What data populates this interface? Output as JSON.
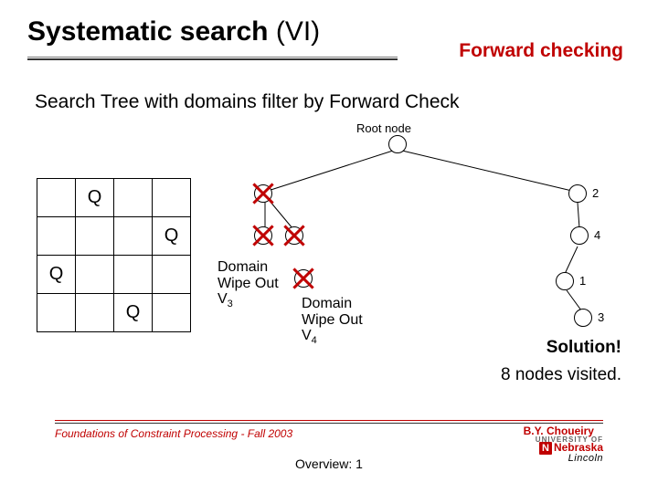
{
  "title": {
    "main": "Systematic search",
    "paren": " (VI)",
    "right": "Forward checking"
  },
  "subtitle": "Search Tree with domains filter by Forward Check",
  "root_label": "Root node",
  "wipe1": {
    "l1": "Domain",
    "l2": "Wipe Out",
    "var": "V",
    "sub": "3"
  },
  "wipe2": {
    "l1": "Domain",
    "l2": "Wipe Out",
    "var": "V",
    "sub": "4"
  },
  "node_labels": {
    "n2": "2",
    "n4": "4",
    "n1": "1",
    "n3": "3"
  },
  "solution": "Solution!",
  "visited": "8 nodes visited.",
  "board": {
    "Q": "Q"
  },
  "footer": {
    "left": "Foundations of Constraint Processing - Fall 2003",
    "right_name": "B.Y. Choueiry",
    "uni_small": "UNIVERSITY OF",
    "uni_big": "Nebraska",
    "uni_city": "Lincoln",
    "overview": "Overview: 1"
  },
  "chart_data": {
    "type": "tree",
    "title": "Search Tree with domains filter by Forward Check",
    "annotations": [
      "Domain Wipe Out V3",
      "Domain Wipe Out V4",
      "Solution!",
      "8 nodes visited."
    ],
    "nodes": [
      {
        "id": "root",
        "label": "Root node",
        "crossed": false,
        "level": 0
      },
      {
        "id": "a1",
        "label": "",
        "crossed": true,
        "level": 1
      },
      {
        "id": "a2",
        "label": "2",
        "crossed": false,
        "level": 1
      },
      {
        "id": "b1",
        "label": "",
        "crossed": true,
        "level": 2
      },
      {
        "id": "b2",
        "label": "",
        "crossed": true,
        "level": 2
      },
      {
        "id": "b3",
        "label": "4",
        "crossed": false,
        "level": 2
      },
      {
        "id": "c1",
        "label": "1",
        "crossed": true,
        "level": 3,
        "note": "Domain Wipe Out V3"
      },
      {
        "id": "d1",
        "label": "3",
        "crossed": false,
        "level": 4,
        "note": "Domain Wipe Out V4"
      }
    ],
    "edges": [
      [
        "root",
        "a1"
      ],
      [
        "root",
        "a2"
      ],
      [
        "a1",
        "b1"
      ],
      [
        "a1",
        "b2"
      ],
      [
        "a2",
        "b3"
      ],
      [
        "b3",
        "c1"
      ],
      [
        "c1",
        "d1"
      ]
    ],
    "board_solution": {
      "size": 4,
      "queens_by_row": [
        2,
        4,
        1,
        3
      ]
    }
  }
}
